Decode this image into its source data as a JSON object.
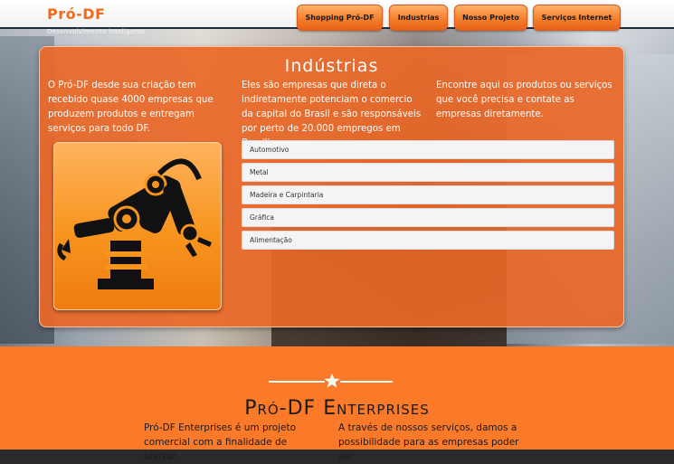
{
  "header": {
    "logo": "Pró-DF",
    "tagline": "Desenvolvimento inteligente",
    "nav": [
      {
        "label": "Shopping Pró-DF"
      },
      {
        "label": "Industrias"
      },
      {
        "label": "Nosso Projeto"
      },
      {
        "label": "Serviços Internet"
      }
    ]
  },
  "industries": {
    "title": "Indústrias",
    "col1": "O Pró-DF desde sua criação tem recebido quase 4000 empresas que produzem produtos e entregam serviços para todo DF.",
    "col2": "Eles são empresas que direta o indiretamente potenciam o comercio da capital do Brasil e são responsáveis por perto de 20.000 empregos em Brasilia.",
    "col3": "Encontre aqui os produtos ou serviços que você precisa e contate as empresas diretamente.",
    "image_icon": "robot-arm-icon",
    "items": [
      {
        "label": "Automotivo"
      },
      {
        "label": "Metal"
      },
      {
        "label": "Madeira e Carpintaria"
      },
      {
        "label": "Gráfica"
      },
      {
        "label": "Alimentação"
      }
    ]
  },
  "enterprises": {
    "title": "Pró-DF Enterprises",
    "col1": "Pró-DF Enterprises é um projeto comercial com a finalidade de ofertar",
    "col2": "A través de nossos serviços, damos a possibilidade para as empresas poder ser"
  },
  "colors": {
    "accent": "#f47b28",
    "band": "#fb7a2a",
    "panel": "#eb6828"
  }
}
